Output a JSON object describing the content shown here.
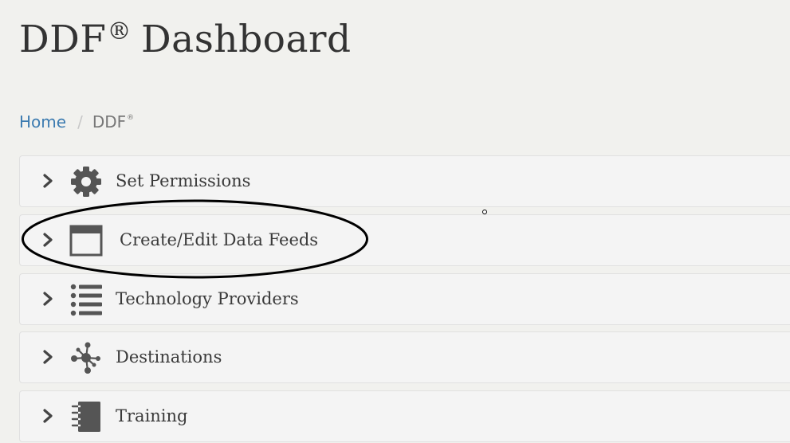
{
  "page": {
    "title_main": "DDF",
    "title_reg": "®",
    "title_rest": "Dashboard"
  },
  "breadcrumb": {
    "home": "Home",
    "separator": "/",
    "current": "DDF",
    "current_reg": "®"
  },
  "panels": [
    {
      "label": "Set Permissions",
      "icon": "gear-icon"
    },
    {
      "label": "Create/Edit Data Feeds",
      "icon": "window-icon"
    },
    {
      "label": "Technology Providers",
      "icon": "list-icon"
    },
    {
      "label": "Destinations",
      "icon": "network-icon"
    },
    {
      "label": "Training",
      "icon": "notebook-icon"
    }
  ],
  "colors": {
    "background": "#f1f1ee",
    "link": "#3c7bb0",
    "icon": "#555555",
    "panel": "#f4f4f4"
  }
}
